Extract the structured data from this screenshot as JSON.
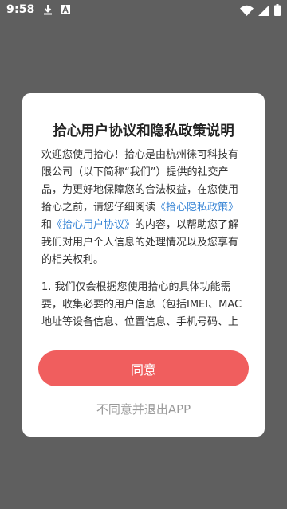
{
  "status_bar": {
    "time": "9:58",
    "icons": [
      "download-icon",
      "font-a-icon",
      "wifi-icon",
      "signal-icon",
      "battery-icon"
    ]
  },
  "dialog": {
    "title": "拾心用户协议和隐私政策说明",
    "paragraph1": {
      "text1": "欢迎您使用拾心！拾心是由杭州徕可科技有限公司（以下简称“我们”）提供的社交产品，为更好地保障您的合法权益，在您使用拾心之前，请您仔细阅读",
      "link_privacy": "《拾心隐私政策》",
      "and": "和",
      "link_user": "《拾心用户协议》",
      "text2": "的内容，以帮助您了解我们对用户个人信息的处理情况以及您享有的相关权利。"
    },
    "paragraph2": "1. 我们仅会根据您使用拾心的具体功能需要，收集必要的用户信息（包括IMEI、MAC地址等设备信息、位置信息、手机号码、上",
    "agree_label": "同意",
    "disagree_label": "不同意并退出APP"
  },
  "colors": {
    "overlay": "#5f5f5f",
    "accent": "#f05e5e",
    "link": "#3a86d6"
  }
}
